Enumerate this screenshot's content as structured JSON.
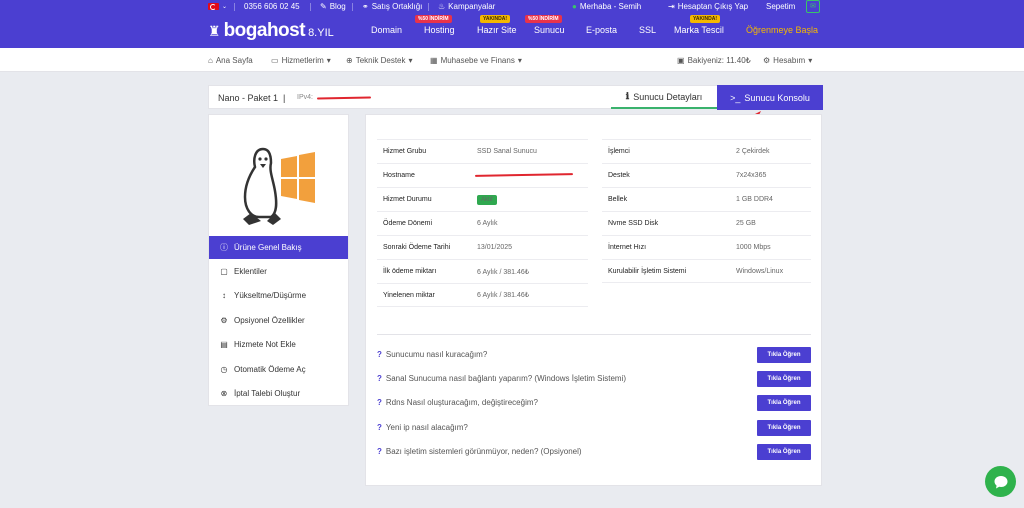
{
  "topbar": {
    "phone": "0356 606 02 45",
    "links": [
      "Blog",
      "Satış Ortaklığı",
      "Kampanyalar"
    ],
    "greeting": "Merhaba - Semih",
    "logout": "Hesaptan Çıkış Yap",
    "cart": "Sepetim"
  },
  "nav": {
    "logo_name": "bogahost",
    "logo_suffix": "8.YIL",
    "items": [
      {
        "label": "Domain",
        "tag": ""
      },
      {
        "label": "Hosting",
        "tag": "%50 İNDİRİM"
      },
      {
        "label": "Hazır Site",
        "tag": "YAKINDA!"
      },
      {
        "label": "Sunucu",
        "tag": "%50 İNDİRİM"
      },
      {
        "label": "E-posta",
        "tag": ""
      },
      {
        "label": "SSL",
        "tag": ""
      },
      {
        "label": "Marka Tescil",
        "tag": "YAKINDA!"
      },
      {
        "label": "Öğrenmeye Başla",
        "tag": ""
      }
    ],
    "accent_color": "#f5b800"
  },
  "subnav": {
    "items": [
      "Ana Sayfa",
      "Hizmetlerim",
      "Teknik Destek",
      "Muhasebe ve Finans"
    ],
    "balance": "Bakiyeniz: 11.40₺",
    "account": "Hesabım"
  },
  "service": {
    "title": "Nano - Paket 1",
    "ip_label": "IPv4:",
    "tab_details": "Sunucu Detayları",
    "tab_console": "Sunucu Konsolu"
  },
  "sidebar": {
    "items": [
      {
        "label": "Ürüne Genel Bakış",
        "icon": "info-icon"
      },
      {
        "label": "Eklentiler",
        "icon": "box-icon"
      },
      {
        "label": "Yükseltme/Düşürme",
        "icon": "updown-icon"
      },
      {
        "label": "Opsiyonel Özellikler",
        "icon": "gear-icon"
      },
      {
        "label": "Hizmete Not Ekle",
        "icon": "note-icon"
      },
      {
        "label": "Otomatik Ödeme Aç",
        "icon": "clock-icon"
      },
      {
        "label": "İptal Talebi Oluştur",
        "icon": "cancel-icon"
      }
    ]
  },
  "info_left": [
    {
      "key": "Hizmet Grubu",
      "value": "SSD Sanal Sunucu"
    },
    {
      "key": "Hostname",
      "value": ""
    },
    {
      "key": "Hizmet Durumu",
      "value": "Aktif"
    },
    {
      "key": "Ödeme Dönemi",
      "value": "6 Aylık"
    },
    {
      "key": "Sonraki Ödeme Tarihi",
      "value": "13/01/2025"
    },
    {
      "key": "İlk ödeme miktarı",
      "value": "6 Aylık / 381.46₺"
    },
    {
      "key": "Yinelenen miktar",
      "value": "6 Aylık / 381.46₺"
    }
  ],
  "info_right": [
    {
      "key": "İşlemci",
      "value": "2 Çekirdek"
    },
    {
      "key": "Destek",
      "value": "7x24x365"
    },
    {
      "key": "Bellek",
      "value": "1 GB DDR4"
    },
    {
      "key": "Nvme SSD Disk",
      "value": "25 GB"
    },
    {
      "key": "İnternet Hızı",
      "value": "1000 Mbps"
    },
    {
      "key": "Kurulabilir İşletim Sistemi",
      "value": "Windows/Linux"
    }
  ],
  "faq": {
    "button_label": "Tıkla Öğren",
    "questions": [
      "Sunucumu nasıl kuracağım?",
      "Sanal Sunucuma nasıl bağlantı yaparım? (Windows İşletim Sistemi)",
      "Rdns Nasıl oluşturacağım, değiştireceğim?",
      "Yeni ip nasıl alacağım?",
      "Bazı işletim sistemleri görünmüyor, neden? (Opsiyonel)"
    ]
  }
}
